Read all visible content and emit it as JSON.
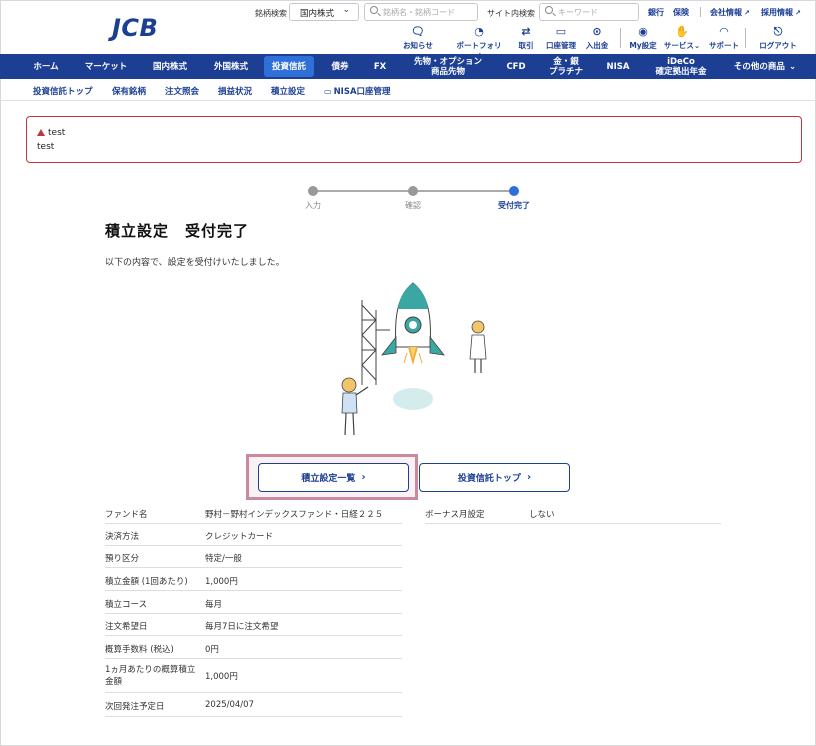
{
  "header": {
    "logo": "JCB",
    "stock_search_label": "銘柄検索",
    "market_select": "国内株式",
    "stock_search_placeholder": "銘柄名・銘柄コード",
    "site_search_label": "サイト内検索",
    "site_search_placeholder": "キーワード",
    "links": [
      "銀行",
      "保険",
      "会社情報",
      "採用情報"
    ],
    "icon_buttons": [
      {
        "label": "お知らせ",
        "icon": "message-icon"
      },
      {
        "label": "ポートフォリオ",
        "icon": "pie-icon"
      },
      {
        "label": "取引",
        "icon": "transfer-icon"
      },
      {
        "label": "口座管理",
        "icon": "card-icon"
      },
      {
        "label": "入出金",
        "icon": "yen-icon"
      },
      {
        "label": "My設定",
        "icon": "user-icon"
      },
      {
        "label": "サービス",
        "icon": "hand-icon"
      },
      {
        "label": "サポート",
        "icon": "headset-icon"
      },
      {
        "label": "ログアウト",
        "icon": "logout-icon"
      }
    ]
  },
  "main_nav": [
    "ホーム",
    "マーケット",
    "国内株式",
    "外国株式",
    "投資信託",
    "債券",
    "FX",
    "先物・オプション\n商品先物",
    "CFD",
    "金・銀\nプラチナ",
    "NISA",
    "iDeCo\n確定拠出年金",
    "その他の商品"
  ],
  "sub_nav": [
    "投資信託トップ",
    "保有銘柄",
    "注文照会",
    "損益状況",
    "積立設定",
    "NISA口座管理"
  ],
  "alert": {
    "line1": "test",
    "line2": "test"
  },
  "steps": [
    "入力",
    "確認",
    "受付完了"
  ],
  "page_title": "積立設定　受付完了",
  "description": "以下の内容で、設定を受付けいたしました。",
  "buttons": {
    "list": "積立設定一覧",
    "top": "投資信託トップ"
  },
  "details": [
    {
      "k": "ファンド名",
      "v": "野村－野村インデックスファンド・日経２２５"
    },
    {
      "k": "決済方法",
      "v": "クレジットカード"
    },
    {
      "k": "預り区分",
      "v": "特定/一般"
    },
    {
      "k": "積立金額 (1回あたり)",
      "v": "1,000円"
    },
    {
      "k": "積立コース",
      "v": "毎月"
    },
    {
      "k": "注文希望日",
      "v": "毎月7日に注文希望"
    },
    {
      "k": "概算手数料 (税込)",
      "v": "0円"
    },
    {
      "k": "1ヵ月あたりの概算積立\n金額",
      "v": "1,000円"
    },
    {
      "k": "次回発注予定日",
      "v": "2025/04/07"
    }
  ],
  "bonus": {
    "k": "ボーナス月設定",
    "v": "しない"
  }
}
